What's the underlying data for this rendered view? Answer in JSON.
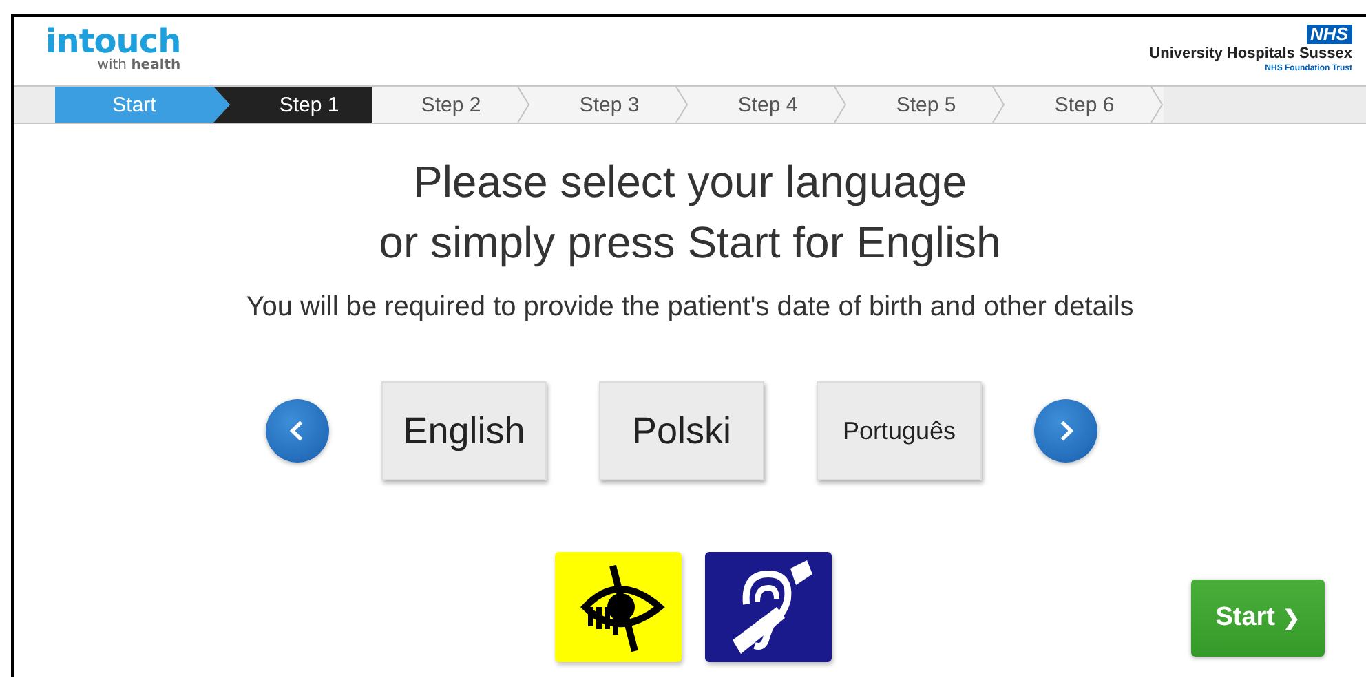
{
  "logo": {
    "name": "intouch",
    "tagline": "with **health**"
  },
  "trust": {
    "badge": "NHS",
    "name": "University Hospitals Sussex",
    "subtitle": "NHS Foundation Trust"
  },
  "steps": [
    {
      "label": "Start",
      "completed": true,
      "selected": false
    },
    {
      "label": "Step 1",
      "completed": false,
      "selected": true
    },
    {
      "label": "Step 2",
      "completed": false,
      "selected": false
    },
    {
      "label": "Step 3",
      "completed": false,
      "selected": false
    },
    {
      "label": "Step 4",
      "completed": false,
      "selected": false
    },
    {
      "label": "Step 5",
      "completed": false,
      "selected": false
    },
    {
      "label": "Step 6",
      "completed": false,
      "selected": false
    }
  ],
  "heading": [
    "Please select your language",
    "or simply press Start for English"
  ],
  "instruction": "You will be required to provide the patient's date of birth and other details",
  "languages": [
    {
      "label": "English"
    },
    {
      "label": "Polski"
    },
    {
      "label": "Português"
    }
  ],
  "accessibility": [
    {
      "kind": "vision"
    },
    {
      "kind": "hearing"
    }
  ],
  "start_button": {
    "label": "Start",
    "arrow": "❯"
  }
}
